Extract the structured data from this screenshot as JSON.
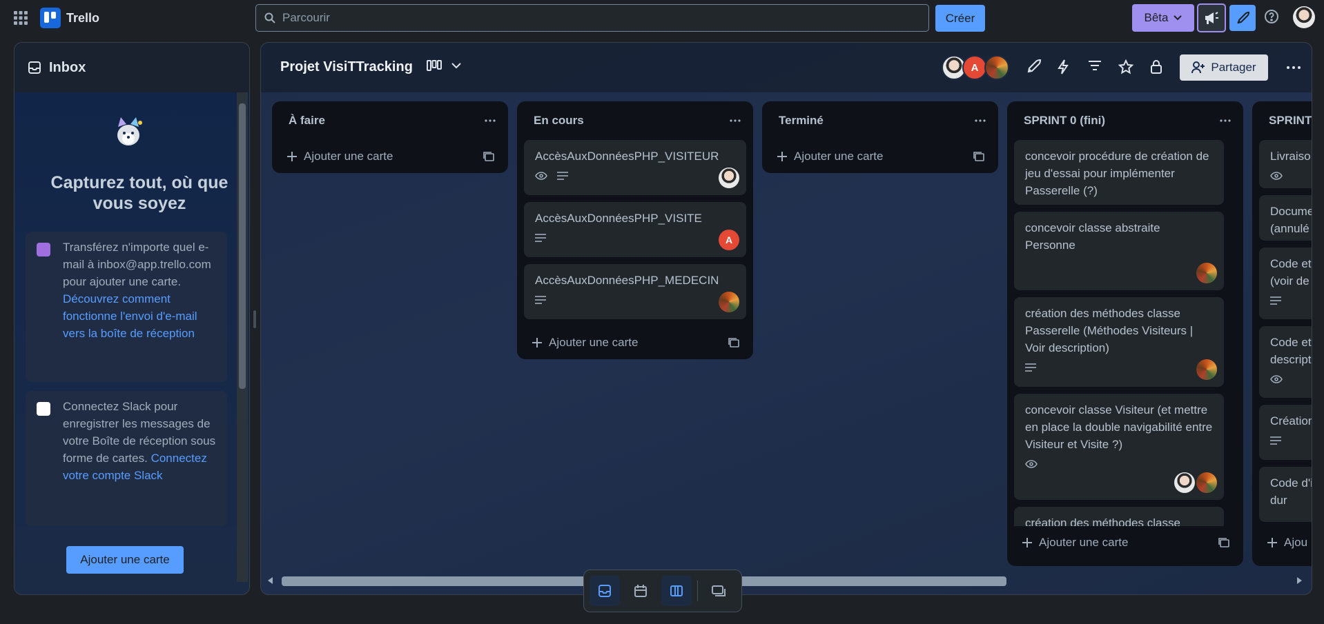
{
  "topbar": {
    "app_name": "Trello",
    "search_placeholder": "Parcourir",
    "create_label": "Créer",
    "beta_label": "Bêta"
  },
  "inbox": {
    "title": "Inbox",
    "headline": "Capturez tout, où que vous soyez",
    "email_text": "Transférez n'importe quel e-mail à inbox@app.trello.com pour ajouter une carte.",
    "email_link": "Découvrez comment fonctionne l'envoi d'e-mail vers la boîte de réception",
    "slack_text": "Connectez Slack pour enregistrer les messages de votre Boîte de réception sous forme de cartes.",
    "slack_link": "Connectez votre compte Slack",
    "add_card": "Ajouter une carte"
  },
  "board": {
    "title": "Projet VisiTTracking",
    "share_label": "Partager",
    "member_initial": "A"
  },
  "lists": [
    {
      "title": "À faire",
      "add_label": "Ajouter une carte"
    },
    {
      "title": "En cours",
      "add_label": "Ajouter une carte",
      "cards": [
        "AccèsAuxDonnéesPHP_VISITEUR",
        "AccèsAuxDonnéesPHP_VISITE",
        "AccèsAuxDonnéesPHP_MEDECIN"
      ]
    },
    {
      "title": "Terminé",
      "add_label": "Ajouter une carte"
    },
    {
      "title": "SPRINT 0 (fini)",
      "add_label": "Ajouter une carte",
      "cards": [
        "concevoir procédure de création de jeu d'essai pour implémenter Passerelle (?)",
        "concevoir classe abstraite Personne",
        "création des méthodes classe Passerelle (Méthodes Visiteurs | Voir description)",
        "concevoir classe Visiteur (et mettre en place la double navigabilité entre Visiteur et Visite ?)",
        "création des méthodes classe"
      ]
    },
    {
      "title": "SPRINT",
      "add_label": "Ajou",
      "cards": [
        "Livraiso",
        "Docume (annulé",
        "Code et (voir de",
        "Code et descript",
        "Création",
        "Code d'i dur"
      ]
    }
  ],
  "colors": {
    "accent": "#579dff",
    "beta": "#9f8fef",
    "avatar_a": "#e34935"
  }
}
